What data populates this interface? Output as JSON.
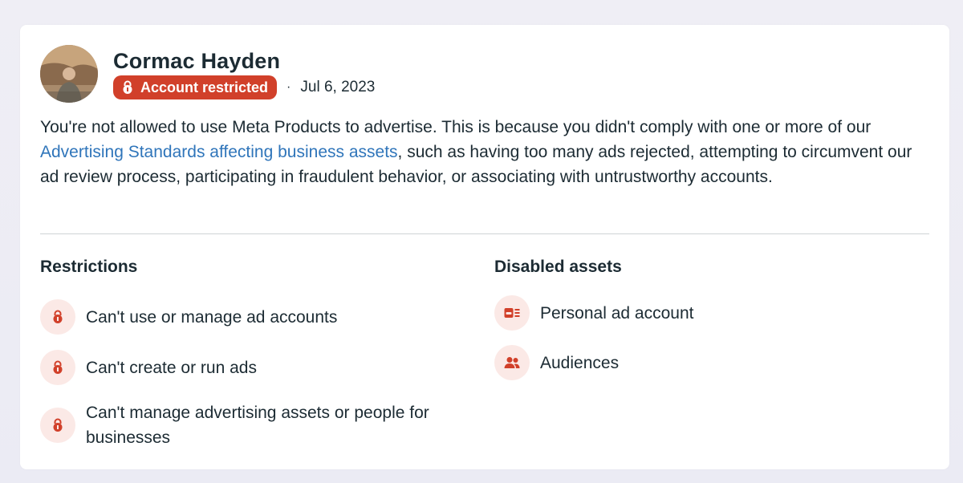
{
  "profile": {
    "name": "Cormac Hayden",
    "status_badge": "Account restricted",
    "separator": "·",
    "date": "Jul 6, 2023"
  },
  "notice": {
    "text_before": "You're not allowed to use Meta Products to advertise. This is because you didn't comply with one or more of our ",
    "link_text": "Advertising Standards affecting business assets",
    "text_after": ", such as having too many ads rejected, attempting to circumvent our ad review process, participating in fraudulent behavior, or associating with untrustworthy accounts."
  },
  "restrictions": {
    "title": "Restrictions",
    "items": [
      {
        "label": "Can't use or manage ad accounts",
        "icon": "lock-icon"
      },
      {
        "label": "Can't create or run ads",
        "icon": "lock-icon"
      },
      {
        "label": "Can't manage advertising assets or people for businesses",
        "icon": "lock-icon"
      }
    ]
  },
  "disabled_assets": {
    "title": "Disabled assets",
    "items": [
      {
        "label": "Personal ad account",
        "icon": "ad-account-icon"
      },
      {
        "label": "Audiences",
        "icon": "people-icon"
      }
    ]
  },
  "colors": {
    "accent_red": "#d1402a",
    "icon_bg": "#fbe9e6",
    "link_blue": "#2f75ba",
    "text": "#1c2b33"
  }
}
